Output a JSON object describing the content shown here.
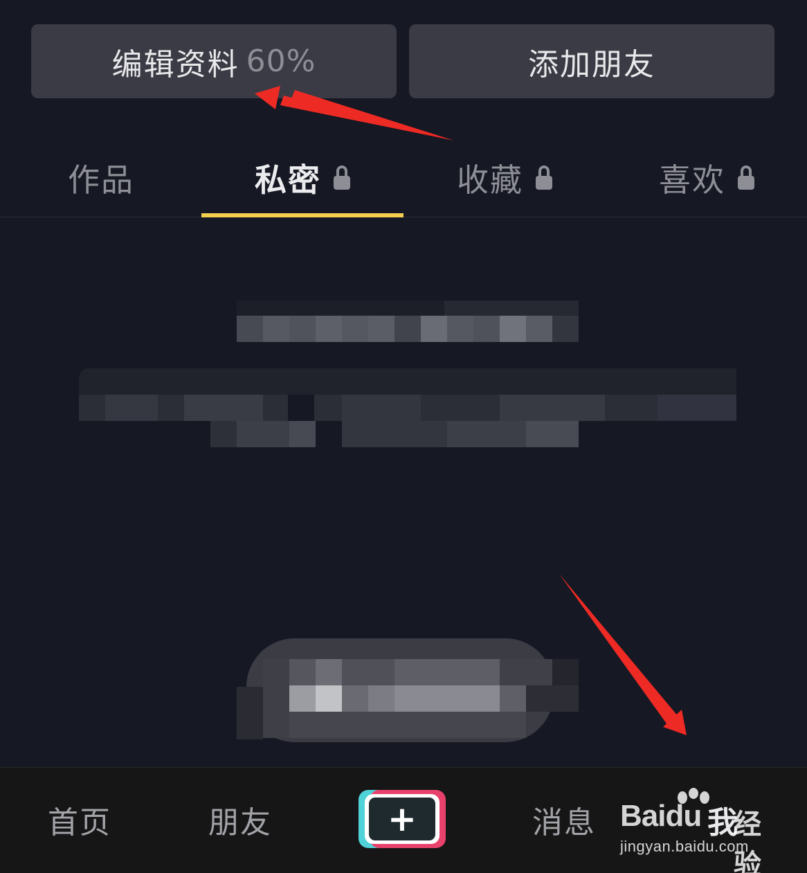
{
  "actions": {
    "edit_profile_label": "编辑资料",
    "edit_profile_percent": "60%",
    "add_friends_label": "添加朋友"
  },
  "tabs": [
    {
      "label": "作品",
      "locked": false,
      "active": false
    },
    {
      "label": "私密",
      "locked": true,
      "active": true
    },
    {
      "label": "收藏",
      "locked": true,
      "active": false
    },
    {
      "label": "喜欢",
      "locked": true,
      "active": false
    }
  ],
  "colors": {
    "background": "#161823",
    "button_bg": "#3a3b44",
    "tab_indicator": "#f5cf4f",
    "annotation_arrow": "#ee2a24",
    "nav_bg": "#161616"
  },
  "bottom_nav": {
    "home": "首页",
    "friends": "朋友",
    "create_icon": "plus-icon",
    "create_symbol": "+",
    "messages": "消息",
    "me": "我"
  },
  "watermark": {
    "brand": "Bai",
    "brand_du": "du",
    "suffix": "经验",
    "url": "jingyan.baidu.com"
  }
}
